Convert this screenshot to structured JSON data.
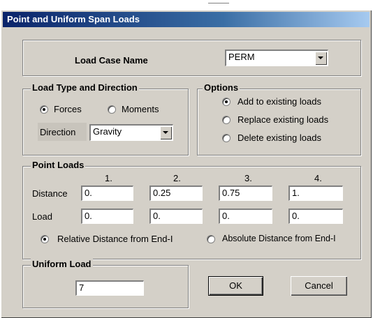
{
  "window": {
    "title": "Point and Uniform Span Loads"
  },
  "load_case": {
    "label": "Load Case Name",
    "value": "PERM"
  },
  "load_type": {
    "legend": "Load Type and Direction",
    "forces_label": "Forces",
    "moments_label": "Moments",
    "selected": "Forces",
    "direction_label": "Direction",
    "direction_value": "Gravity"
  },
  "options": {
    "legend": "Options",
    "add_label": "Add to existing loads",
    "replace_label": "Replace existing loads",
    "delete_label": "Delete existing loads",
    "selected": "Add to existing loads"
  },
  "point_loads": {
    "legend": "Point Loads",
    "headers": [
      "1.",
      "2.",
      "3.",
      "4."
    ],
    "distance_label": "Distance",
    "load_label": "Load",
    "distances": [
      "0.",
      "0.25",
      "0.75",
      "1."
    ],
    "loads": [
      "0.",
      "0.",
      "0.",
      "0."
    ],
    "relative_label": "Relative Distance from End-I",
    "absolute_label": "Absolute Distance from End-I",
    "selected": "Relative Distance from End-I"
  },
  "uniform_load": {
    "legend": "Uniform Load",
    "value": "7"
  },
  "buttons": {
    "ok": "OK",
    "cancel": "Cancel"
  }
}
